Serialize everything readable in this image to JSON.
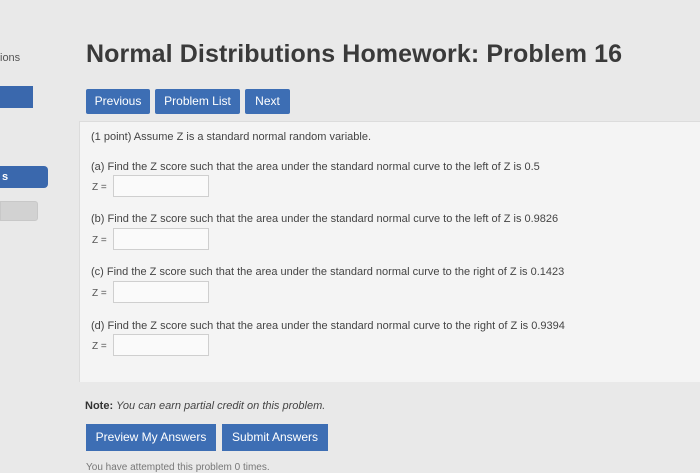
{
  "sidebar": {
    "label": "ions",
    "tab_label": "s"
  },
  "page_title": "Normal Distributions Homework: Problem 16",
  "nav": {
    "previous": "Previous",
    "problem_list": "Problem List",
    "next": "Next"
  },
  "problem": {
    "intro": "(1 point) Assume Z is a standard normal random variable.",
    "parts": [
      {
        "question": "(a) Find the Z score such that the area under the standard normal curve to the left of Z is 0.5",
        "z_label": "Z =",
        "value": ""
      },
      {
        "question": "(b) Find the Z score such that the area under the standard normal curve to the left of Z is 0.9826",
        "z_label": "Z =",
        "value": ""
      },
      {
        "question": "(c) Find the Z score such that the area under the standard normal curve to the right of Z is 0.1423",
        "z_label": "Z =",
        "value": ""
      },
      {
        "question": "(d) Find the Z score such that the area under the standard normal curve to the right of Z is 0.9394",
        "z_label": "Z =",
        "value": ""
      }
    ]
  },
  "note": {
    "label": "Note:",
    "text": "You can earn partial credit on this problem."
  },
  "actions": {
    "preview": "Preview My Answers",
    "submit": "Submit Answers"
  },
  "footer": "You have attempted this problem 0 times."
}
